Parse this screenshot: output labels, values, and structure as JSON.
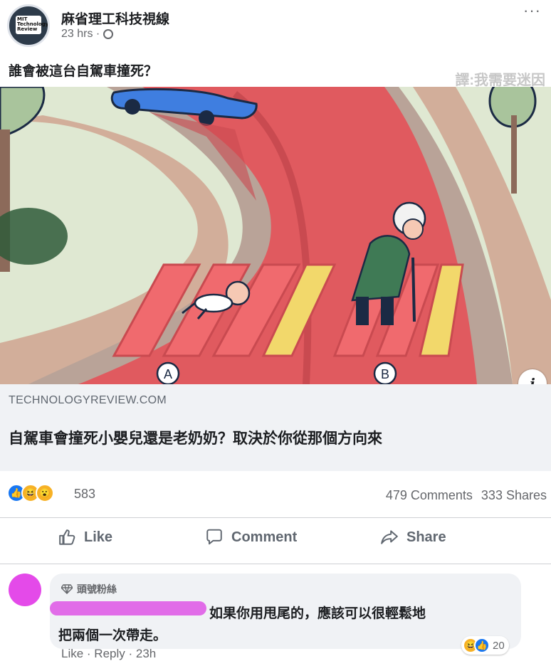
{
  "post": {
    "page_name": "麻省理工科技視線",
    "avatar_text": "MIT Technology Review",
    "time": "23 hrs ·",
    "more": "···",
    "caption": "誰會被這台自駕車撞死？",
    "watermark": "譯:我需要迷因",
    "illustration": {
      "label_a": "A",
      "label_b": "B"
    },
    "info_icon": "i"
  },
  "link": {
    "domain": "TECHNOLOGYREVIEW.COM",
    "headline": "自駕車會撞死小嬰兒還是老奶奶？取決於你從那個方向來"
  },
  "stats": {
    "reaction_count": "583",
    "comments": "479 Comments",
    "shares": "333 Shares"
  },
  "actions": {
    "like": "Like",
    "comment": "Comment",
    "share": "Share"
  },
  "comment": {
    "badge": "頭號粉絲",
    "text_line1": "如果你用甩尾的，應該可以很輕鬆地",
    "text_line2": "把兩個一次帶走。",
    "meta": "Like · Reply · 23h",
    "reaction_count": "20"
  },
  "colors": {
    "road_red": "#e05a5f",
    "crossing_yellow": "#f2d86b",
    "grass": "#dfe8d2",
    "car_blue": "#3f7ee0",
    "fb_blue": "#1877f2"
  }
}
